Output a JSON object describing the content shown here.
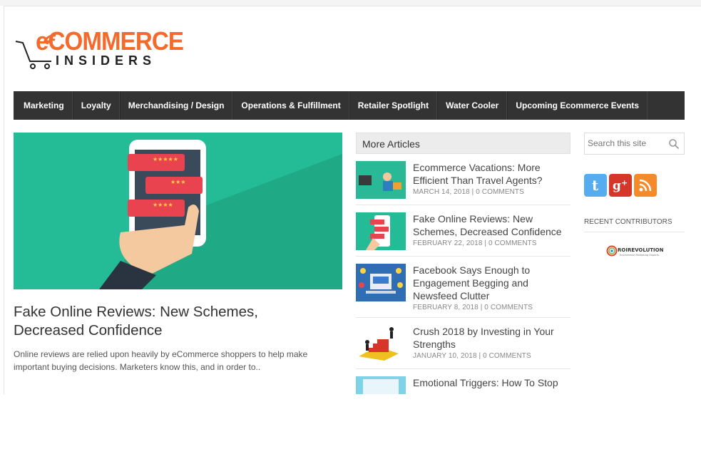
{
  "logo": {
    "line1": "eCOMMERCE",
    "line2": "INSIDERS"
  },
  "nav": [
    "Marketing",
    "Loyalty",
    "Merchandising / Design",
    "Operations & Fulfillment",
    "Retailer Spotlight",
    "Water Cooler",
    "Upcoming Ecommerce Events"
  ],
  "featured": {
    "title": "Fake Online Reviews: New Schemes, Decreased Confidence",
    "excerpt": "Online reviews are relied upon heavily by eCommerce shoppers to help make important buying decisions. Marketers know this, and in order to.."
  },
  "more_articles": {
    "heading": "More Articles",
    "items": [
      {
        "title": "Ecommerce Vacations: More Efficient Than Travel Agents?",
        "meta": "MARCH 14, 2018 | 0 COMMENTS"
      },
      {
        "title": "Fake Online Reviews: New Schemes, Decreased Confidence",
        "meta": "FEBRUARY 22, 2018 | 0 COMMENTS"
      },
      {
        "title": "Facebook Says Enough to Engagement Begging and Newsfeed Clutter",
        "meta": "FEBRUARY 8, 2018 | 0 COMMENTS"
      },
      {
        "title": "Crush 2018 by Investing in Your Strengths",
        "meta": "JANUARY 10, 2018 | 0 COMMENTS"
      },
      {
        "title": "Emotional Triggers: How To Stop",
        "meta": ""
      }
    ]
  },
  "sidebar": {
    "search_placeholder": "Search this site",
    "recent_contributors_label": "RECENT CONTRIBUTORS",
    "contributor_logo": "ROIREVOLUTION",
    "contributor_tagline": "Ecommerce Marketing Experts",
    "social": [
      "twitter-icon",
      "google-plus-icon",
      "rss-icon"
    ]
  },
  "colors": {
    "brand_orange": "#f26a2c",
    "nav_bg": "#333333",
    "feature_bg": "#24bc96",
    "twitter": "#55acee",
    "google_plus": "#d6362a",
    "rss": "#f58a2a"
  }
}
